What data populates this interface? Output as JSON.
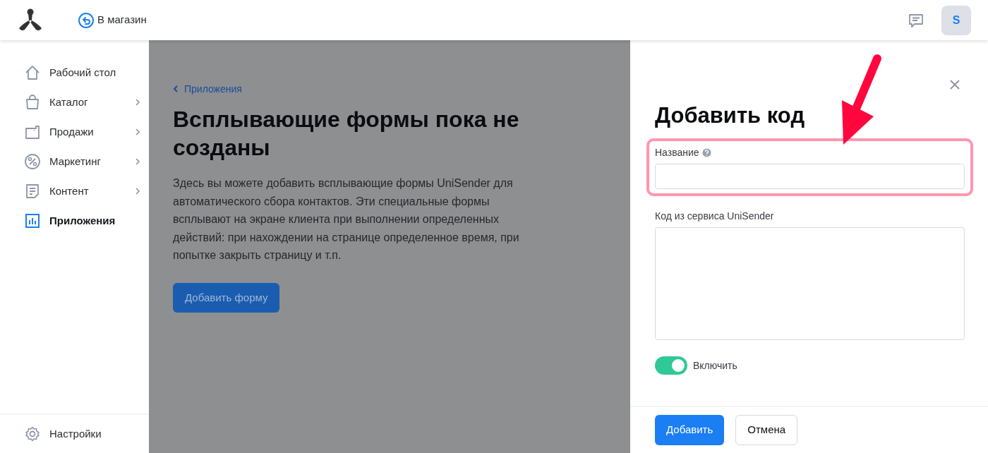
{
  "header": {
    "back_link": "В магазин",
    "avatar": "S"
  },
  "sidebar": {
    "items": [
      {
        "label": "Рабочий стол",
        "has_submenu": false,
        "selected": false
      },
      {
        "label": "Каталог",
        "has_submenu": true,
        "selected": false
      },
      {
        "label": "Продажи",
        "has_submenu": true,
        "selected": false
      },
      {
        "label": "Маркетинг",
        "has_submenu": true,
        "selected": false
      },
      {
        "label": "Контент",
        "has_submenu": true,
        "selected": false
      },
      {
        "label": "Приложения",
        "has_submenu": false,
        "selected": true
      }
    ],
    "footer_item": {
      "label": "Настройки"
    }
  },
  "main": {
    "breadcrumb": "Приложения",
    "title": "Всплывающие формы пока не созданы",
    "description": "Здесь вы можете добавить всплывающие формы UniSender для автоматического сбора контактов. Эти специальные формы всплывают на экране клиента при выполнении определенных действий: при нахождении на странице определенное время, при попытке закрыть страницу и т.п.",
    "button": "Добавить форму"
  },
  "drawer": {
    "title": "Добавить код",
    "fields": [
      {
        "kind": "input",
        "label": "Название",
        "help": true
      },
      {
        "kind": "textarea",
        "label": "Код из сервиса UniSender",
        "help": false
      }
    ],
    "toggle": {
      "label": "Включить",
      "on": true
    },
    "buttons": [
      {
        "label": "Добавить",
        "kind": "primary"
      },
      {
        "label": "Отмена",
        "kind": "secondary"
      }
    ]
  }
}
